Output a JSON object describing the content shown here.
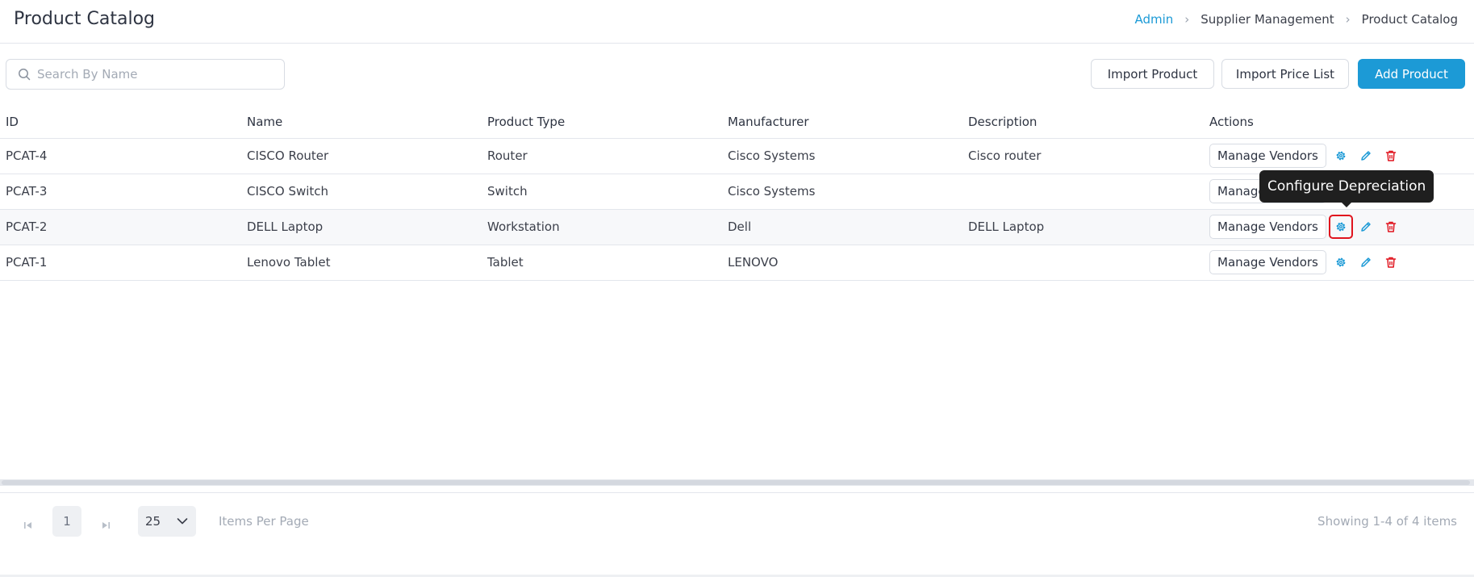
{
  "header": {
    "title": "Product Catalog",
    "breadcrumb": [
      "Admin",
      "Supplier Management",
      "Product Catalog"
    ]
  },
  "toolbar": {
    "search_placeholder": "Search By Name",
    "search_value": "",
    "import_product_label": "Import Product",
    "import_price_list_label": "Import Price List",
    "add_product_label": "Add Product"
  },
  "table": {
    "columns": [
      "ID",
      "Name",
      "Product Type",
      "Manufacturer",
      "Description",
      "Actions"
    ],
    "manage_vendors_label": "Manage Vendors",
    "rows": [
      {
        "id": "PCAT-4",
        "name": "CISCO Router",
        "type": "Router",
        "manufacturer": "Cisco Systems",
        "description": "Cisco router"
      },
      {
        "id": "PCAT-3",
        "name": "CISCO Switch",
        "type": "Switch",
        "manufacturer": "Cisco Systems",
        "description": ""
      },
      {
        "id": "PCAT-2",
        "name": "DELL Laptop",
        "type": "Workstation",
        "manufacturer": "Dell",
        "description": "DELL Laptop"
      },
      {
        "id": "PCAT-1",
        "name": "Lenovo Tablet",
        "type": "Tablet",
        "manufacturer": "LENOVO",
        "description": ""
      }
    ],
    "row_icons": [
      "gear-icon",
      "pencil-icon",
      "trash-icon"
    ]
  },
  "tooltip": {
    "text": "Configure Depreciation"
  },
  "pagination": {
    "current_page": "1",
    "page_size": "25",
    "items_per_page_label": "Items Per Page",
    "showing": "Showing 1-4 of 4 items"
  },
  "colors": {
    "accent": "#1c9ad6",
    "danger": "#e0141e",
    "border": "#e3e6ec"
  }
}
